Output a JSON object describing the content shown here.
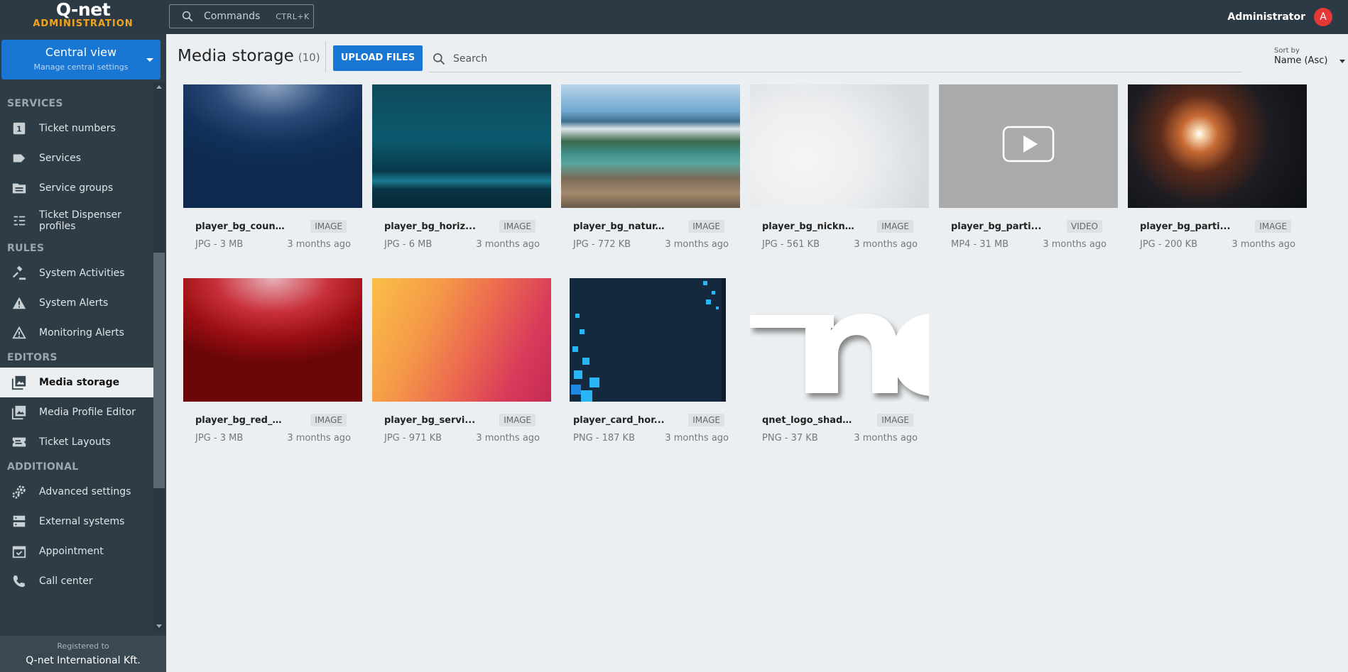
{
  "header": {
    "brand": "Q-net",
    "brand_sub": "ADMINISTRATION",
    "commands_label": "Commands",
    "commands_shortcut": "CTRL+K",
    "user_name": "Administrator",
    "user_initial": "A"
  },
  "sidebar": {
    "central_title": "Central view",
    "central_subtitle": "Manage central settings",
    "sections": [
      {
        "title": "SERVICES",
        "items": [
          {
            "label": "Ticket numbers",
            "icon": "ticket-number-icon"
          },
          {
            "label": "Services",
            "icon": "label-tag-icon"
          },
          {
            "label": "Service groups",
            "icon": "folder-icon"
          },
          {
            "label": "Ticket Dispenser profiles",
            "icon": "dispenser-list-icon"
          }
        ]
      },
      {
        "title": "RULES",
        "items": [
          {
            "label": "System Activities",
            "icon": "gavel-icon"
          },
          {
            "label": "System Alerts",
            "icon": "warning-filled-icon"
          },
          {
            "label": "Monitoring Alerts",
            "icon": "warning-outline-icon"
          }
        ]
      },
      {
        "title": "EDITORS",
        "items": [
          {
            "label": "Media storage",
            "icon": "image-stack-icon",
            "active": true
          },
          {
            "label": "Media Profile Editor",
            "icon": "media-profile-icon"
          },
          {
            "label": "Ticket Layouts",
            "icon": "ticket-layout-icon"
          }
        ]
      },
      {
        "title": "ADDITIONAL",
        "items": [
          {
            "label": "Advanced settings",
            "icon": "gears-icon"
          },
          {
            "label": "External systems",
            "icon": "servers-icon"
          },
          {
            "label": "Appointment",
            "icon": "calendar-check-icon"
          },
          {
            "label": "Call center",
            "icon": "phone-icon"
          }
        ]
      }
    ],
    "registered_label": "Registered to",
    "registered_company": "Q-net International Kft."
  },
  "main": {
    "title": "Media storage",
    "count": "(10)",
    "upload_label": "UPLOAD FILES",
    "search_placeholder": "Search",
    "sort_label": "Sort by",
    "sort_value": "Name (Asc)"
  },
  "files": [
    {
      "name": "player_bg_count...",
      "type": "IMAGE",
      "meta": "JPG - 3 MB",
      "age": "3 months ago",
      "thumb": "blue-gradient"
    },
    {
      "name": "player_bg_horiz...",
      "type": "IMAGE",
      "meta": "JPG - 6 MB",
      "age": "3 months ago",
      "thumb": "teal-wall"
    },
    {
      "name": "player_bg_natur...",
      "type": "IMAGE",
      "meta": "JPG - 772 KB",
      "age": "3 months ago",
      "thumb": "mountain-lake"
    },
    {
      "name": "player_bg_nickn...",
      "type": "IMAGE",
      "meta": "JPG - 561 KB",
      "age": "3 months ago",
      "thumb": "white-curves"
    },
    {
      "name": "player_bg_parti...",
      "type": "VIDEO",
      "meta": "MP4 - 31 MB",
      "age": "3 months ago",
      "thumb": "video-placeholder"
    },
    {
      "name": "player_bg_parti...",
      "type": "IMAGE",
      "meta": "JPG - 200 KB",
      "age": "3 months ago",
      "thumb": "bokeh-particles"
    },
    {
      "name": "player_bg_red_w...",
      "type": "IMAGE",
      "meta": "JPG - 3 MB",
      "age": "3 months ago",
      "thumb": "red-gradient"
    },
    {
      "name": "player_bg_servi...",
      "type": "IMAGE",
      "meta": "JPG - 971 KB",
      "age": "3 months ago",
      "thumb": "orange-curves"
    },
    {
      "name": "player_card_hor...",
      "type": "IMAGE",
      "meta": "PNG - 187 KB",
      "age": "3 months ago",
      "thumb": "dark-card-squares"
    },
    {
      "name": "qnet_logo_shado...",
      "type": "IMAGE",
      "meta": "PNG - 37 KB",
      "age": "3 months ago",
      "thumb": "logo-shadow"
    }
  ],
  "colors": {
    "accent": "#1976d2",
    "topbar": "#2b3a44",
    "sidebar": "#2e3c46",
    "brand_orange": "#f2a51c",
    "avatar": "#e53935"
  }
}
